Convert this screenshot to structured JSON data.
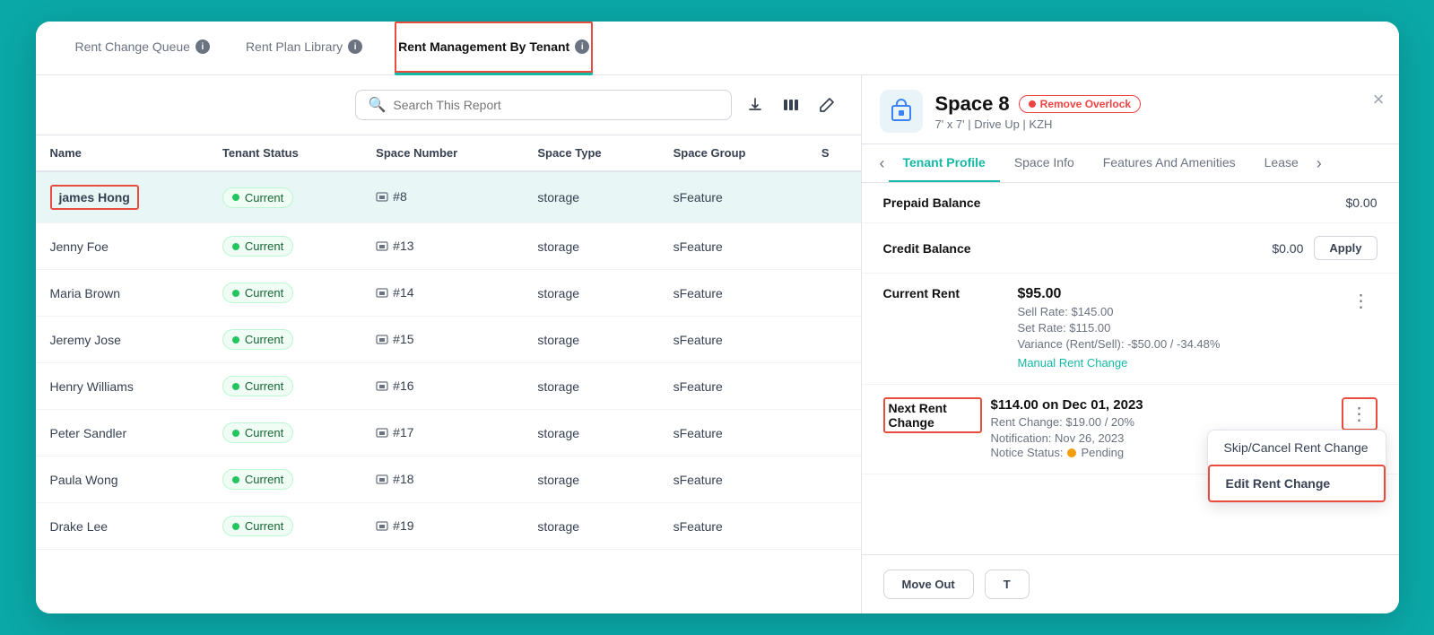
{
  "tabs": [
    {
      "id": "queue",
      "label": "Rent Change Queue",
      "info": true,
      "active": false
    },
    {
      "id": "library",
      "label": "Rent Plan Library",
      "info": true,
      "active": false
    },
    {
      "id": "management",
      "label": "Rent Management By Tenant",
      "info": true,
      "active": true
    }
  ],
  "search": {
    "placeholder": "Search This Report"
  },
  "toolbar_icons": {
    "download": "⬇",
    "columns": "|||",
    "edit": "✎"
  },
  "table": {
    "columns": [
      "Name",
      "Tenant Status",
      "Space Number",
      "Space Type",
      "Space Group",
      "S"
    ],
    "rows": [
      {
        "name": "james Hong",
        "status": "Current",
        "space_number": "#8",
        "space_type": "storage",
        "space_group": "sFeature",
        "selected": true
      },
      {
        "name": "Jenny Foe",
        "status": "Current",
        "space_number": "#13",
        "space_type": "storage",
        "space_group": "sFeature",
        "selected": false
      },
      {
        "name": "Maria Brown",
        "status": "Current",
        "space_number": "#14",
        "space_type": "storage",
        "space_group": "sFeature",
        "selected": false
      },
      {
        "name": "Jeremy Jose",
        "status": "Current",
        "space_number": "#15",
        "space_type": "storage",
        "space_group": "sFeature",
        "selected": false
      },
      {
        "name": "Henry Williams",
        "status": "Current",
        "space_number": "#16",
        "space_type": "storage",
        "space_group": "sFeature",
        "selected": false
      },
      {
        "name": "Peter Sandler",
        "status": "Current",
        "space_number": "#17",
        "space_type": "storage",
        "space_group": "sFeature",
        "selected": false
      },
      {
        "name": "Paula Wong",
        "status": "Current",
        "space_number": "#18",
        "space_type": "storage",
        "space_group": "sFeature",
        "selected": false
      },
      {
        "name": "Drake Lee",
        "status": "Current",
        "space_number": "#19",
        "space_type": "storage",
        "space_group": "sFeature",
        "selected": false
      }
    ]
  },
  "detail_panel": {
    "space_name": "Space 8",
    "overlock_label": "Remove Overlock",
    "subtitle": "7' x 7' | Drive Up | KZH",
    "tabs": [
      "Tenant Profile",
      "Space Info",
      "Features And Amenities",
      "Lease"
    ],
    "active_tab": "Tenant Profile",
    "prepaid_balance_label": "Prepaid Balance",
    "prepaid_balance_value": "$0.00",
    "credit_balance_label": "Credit Balance",
    "credit_balance_value": "$0.00",
    "apply_label": "Apply",
    "current_rent_label": "Current Rent",
    "current_rent_main": "$95.00",
    "sell_rate": "Sell Rate: $145.00",
    "set_rate": "Set Rate: $115.00",
    "variance": "Variance (Rent/Sell): -$50.00 / -34.48%",
    "manual_link": "Manual Rent Change",
    "next_rent_label": "Next Rent Change",
    "next_rent_main": "$114.00 on Dec 01, 2023",
    "rent_change": "Rent Change: $19.00 / 20%",
    "notification": "Notification: Nov 26, 2023",
    "notice_status_label": "Notice Status:",
    "notice_status_value": "Pending",
    "dropdown": {
      "items": [
        {
          "label": "Skip/Cancel Rent Change",
          "highlighted": false
        },
        {
          "label": "Edit Rent Change",
          "highlighted": true
        }
      ]
    },
    "footer_buttons": [
      "Move Out",
      "T"
    ]
  }
}
